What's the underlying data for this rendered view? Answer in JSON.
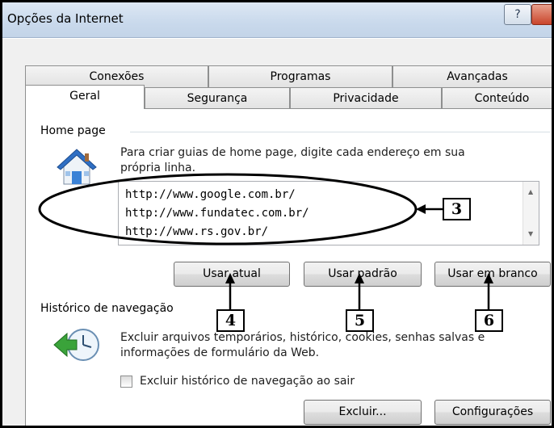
{
  "window": {
    "title": "Opções da Internet",
    "help_glyph": "?"
  },
  "tabs": {
    "row_back": [
      {
        "label": "Conexões"
      },
      {
        "label": "Programas"
      },
      {
        "label": "Avançadas"
      }
    ],
    "row_front": [
      {
        "label": "Geral",
        "active": true
      },
      {
        "label": "Segurança"
      },
      {
        "label": "Privacidade"
      },
      {
        "label": "Conteúdo"
      }
    ]
  },
  "home_page": {
    "group_label": "Home page",
    "description_line1": "Para criar guias de home page, digite cada endereço em sua",
    "description_line2": "própria linha.",
    "urls": [
      "http://www.google.com.br/",
      "http://www.fundatec.com.br/",
      "http://www.rs.gov.br/"
    ],
    "buttons": {
      "current": "Usar atual",
      "default": "Usar padrão",
      "blank": "Usar em branco"
    }
  },
  "history": {
    "group_label": "Histórico de navegação",
    "description_line1": "Excluir arquivos temporários, histórico, cookies, senhas salvas e",
    "description_line2": "informações de formulário da Web.",
    "checkbox_label": "Excluir histórico de navegação ao sair",
    "checkbox_checked": false,
    "buttons": {
      "delete": "Excluir...",
      "settings": "Configurações"
    }
  },
  "annotations": {
    "urls_callout": "3",
    "current_callout": "4",
    "default_callout": "5",
    "blank_callout": "6"
  },
  "icons": {
    "home": "house-icon",
    "history": "clock-arrow-icon",
    "help": "help-icon",
    "close": "close-icon"
  },
  "colors": {
    "titlebar": "#c9d9ec",
    "close_button": "#c9452b",
    "panel": "#ffffff"
  }
}
